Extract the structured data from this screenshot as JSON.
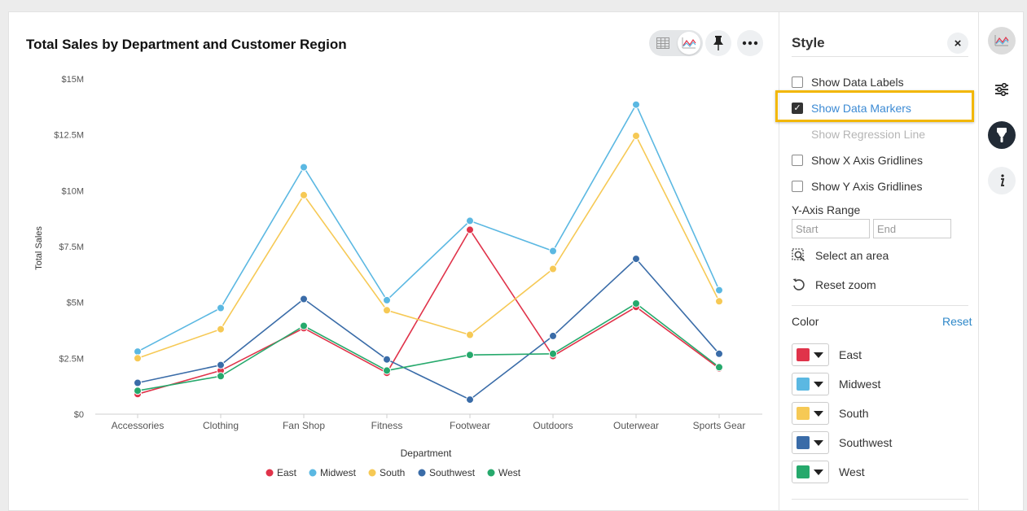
{
  "chart_card": {
    "title": "Total Sales by Department and Customer Region"
  },
  "chart_data": {
    "type": "line",
    "title": "Total Sales by Department and Customer Region",
    "xlabel": "Department",
    "ylabel": "Total Sales",
    "categories": [
      "Accessories",
      "Clothing",
      "Fan Shop",
      "Fitness",
      "Footwear",
      "Outdoors",
      "Outerwear",
      "Sports Gear"
    ],
    "ylim": [
      0,
      15000000
    ],
    "y_ticks": [
      "$0",
      "$2.5M",
      "$5M",
      "$7.5M",
      "$10M",
      "$12.5M",
      "$15M"
    ],
    "grid": false,
    "legend_position": "bottom",
    "markers": true,
    "series": [
      {
        "name": "East",
        "color": "#e0334a",
        "values": [
          900000,
          1950000,
          3850000,
          1850000,
          8250000,
          2600000,
          4800000,
          2050000
        ]
      },
      {
        "name": "Midwest",
        "color": "#5bb8e2",
        "values": [
          2800000,
          4750000,
          11050000,
          5100000,
          8650000,
          7300000,
          13850000,
          5550000
        ]
      },
      {
        "name": "South",
        "color": "#f6c955",
        "values": [
          2500000,
          3800000,
          9800000,
          4650000,
          3550000,
          6500000,
          12450000,
          5050000
        ]
      },
      {
        "name": "Southwest",
        "color": "#3a6ca8",
        "values": [
          1400000,
          2200000,
          5150000,
          2450000,
          650000,
          3500000,
          6950000,
          2700000
        ]
      },
      {
        "name": "West",
        "color": "#26a96c",
        "values": [
          1050000,
          1700000,
          3950000,
          1950000,
          2650000,
          2700000,
          4950000,
          2100000
        ]
      }
    ]
  },
  "style_panel": {
    "title": "Style",
    "close_label": "×",
    "options": [
      {
        "label": "Show Data Labels",
        "checked": false
      },
      {
        "label": "Show Data Markers",
        "checked": true
      },
      {
        "label": "Show Regression Line",
        "checked": false,
        "disabled": true
      },
      {
        "label": "Show X Axis Gridlines",
        "checked": false
      },
      {
        "label": "Show Y Axis Gridlines",
        "checked": false
      }
    ],
    "y_axis_range_label": "Y-Axis Range",
    "start_placeholder": "Start",
    "end_placeholder": "End",
    "select_area_label": "Select an area",
    "reset_zoom_label": "Reset zoom",
    "color_label": "Color",
    "reset_label": "Reset",
    "colors": [
      {
        "name": "East",
        "color": "#e0334a"
      },
      {
        "name": "Midwest",
        "color": "#5bb8e2"
      },
      {
        "name": "South",
        "color": "#f6c955"
      },
      {
        "name": "Southwest",
        "color": "#3a6ca8"
      },
      {
        "name": "West",
        "color": "#26a96c"
      }
    ]
  }
}
